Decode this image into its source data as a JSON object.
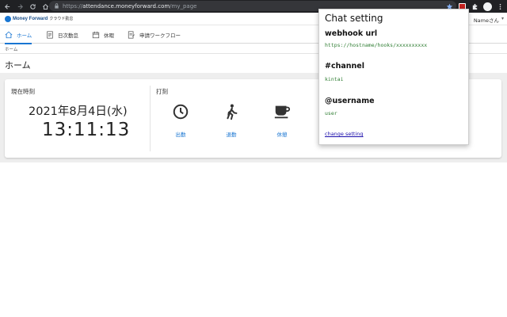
{
  "browser": {
    "url_scheme": "https://",
    "url_host": "attendance.moneyforward.com",
    "url_path": "/my_page"
  },
  "header": {
    "logo_text": "Money Forward",
    "logo_sub": "クラウド勤怠",
    "user_name": "Nameさん",
    "user_caret": "▾"
  },
  "tabs": [
    {
      "label": "ホーム",
      "icon": "home-icon",
      "active": true
    },
    {
      "label": "日次勤怠",
      "icon": "daily-attendance-icon",
      "active": false
    },
    {
      "label": "休暇",
      "icon": "calendar-icon",
      "active": false
    },
    {
      "label": "申請ワークフロー",
      "icon": "workflow-icon",
      "active": false
    }
  ],
  "breadcrumb": "ホーム",
  "page_title": "ホーム",
  "clock": {
    "label": "現在時刻",
    "date": "2021年8月4日(水)",
    "time": "13:11:13"
  },
  "punch": {
    "label": "打刻",
    "buttons": [
      {
        "label": "出勤",
        "icon": "clock-icon"
      },
      {
        "label": "退勤",
        "icon": "walking-icon"
      },
      {
        "label": "休憩",
        "icon": "coffee-icon"
      }
    ]
  },
  "popup": {
    "title": "Chat setting",
    "webhook_label": "webhook url",
    "webhook_value": "https://hostname/hooks/xxxxxxxxxx",
    "channel_label": "#channel",
    "channel_value": "kintai",
    "username_label": "@username",
    "username_value": "user",
    "link": "change setting"
  },
  "colors": {
    "accent": "#1976d2",
    "code_green": "#2e7d32",
    "browser_bg": "#202124"
  }
}
